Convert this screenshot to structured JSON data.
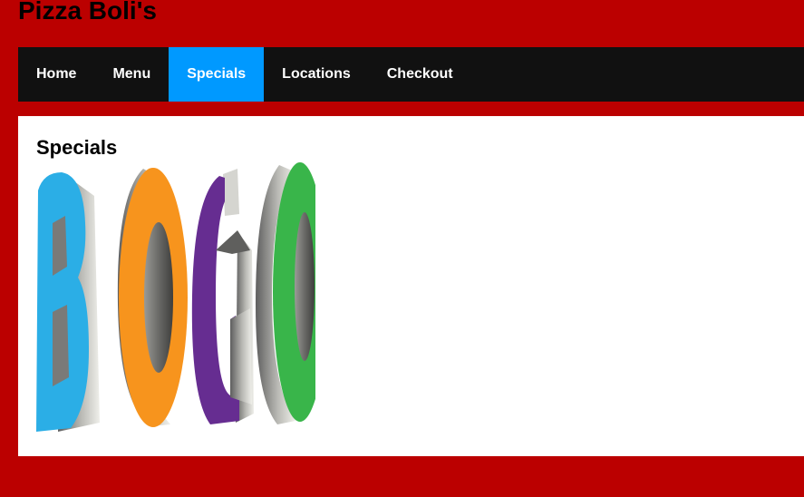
{
  "header": {
    "site_title": "Pizza Boli's"
  },
  "nav": {
    "items": [
      {
        "label": "Home",
        "active": false
      },
      {
        "label": "Menu",
        "active": false
      },
      {
        "label": "Specials",
        "active": true
      },
      {
        "label": "Locations",
        "active": false
      },
      {
        "label": "Checkout",
        "active": false
      }
    ],
    "active_color": "#0099ff",
    "bar_color": "#111111"
  },
  "main": {
    "heading": "Specials",
    "special_image": {
      "letters": [
        {
          "letter": "B",
          "color": "#2baee6"
        },
        {
          "letter": "O",
          "color": "#f7941d"
        },
        {
          "letter": "G",
          "color": "#662d91"
        },
        {
          "letter": "O",
          "color": "#39b54a"
        }
      ]
    }
  },
  "colors": {
    "page_background": "#bb0000",
    "content_background": "#ffffff"
  }
}
